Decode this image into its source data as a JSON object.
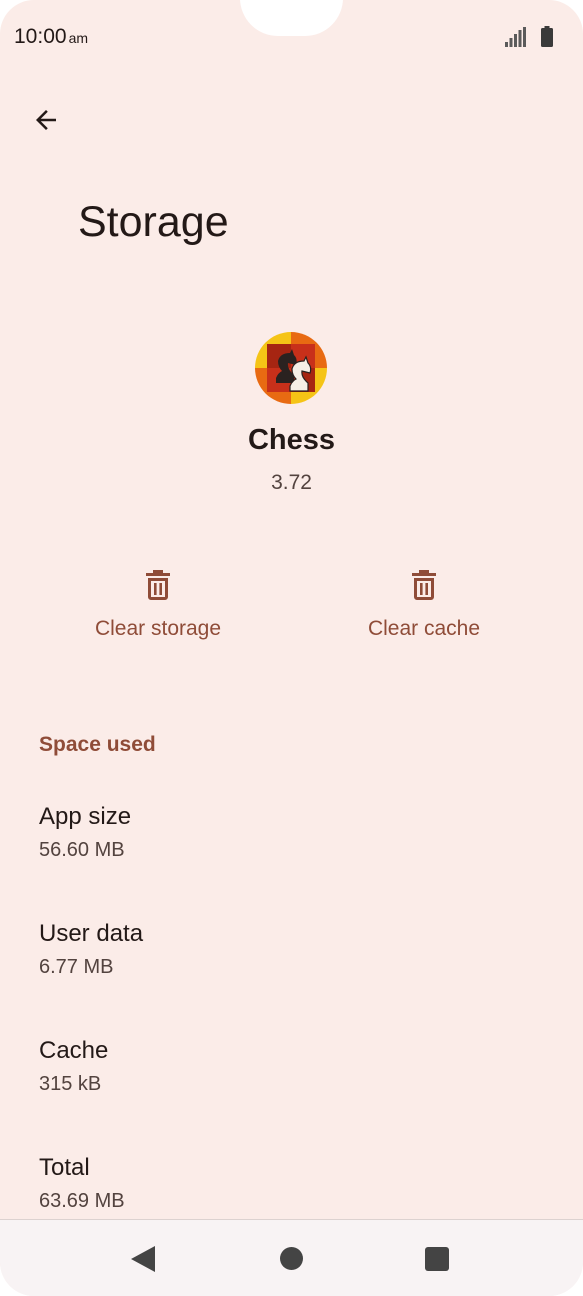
{
  "status_bar": {
    "time": "10:00",
    "ampm": "am"
  },
  "header": {
    "title": "Storage"
  },
  "app": {
    "name": "Chess",
    "version": "3.72",
    "icon": "chess-knight-icon"
  },
  "actions": [
    {
      "label": "Clear storage",
      "icon": "trash-icon"
    },
    {
      "label": "Clear cache",
      "icon": "trash-icon"
    }
  ],
  "space_used": {
    "header": "Space used",
    "rows": [
      {
        "title": "App size",
        "value": "56.60 MB"
      },
      {
        "title": "User data",
        "value": "6.77 MB"
      },
      {
        "title": "Cache",
        "value": "315 kB"
      },
      {
        "title": "Total",
        "value": "63.69 MB"
      }
    ]
  },
  "colors": {
    "background": "#fbece8",
    "accent": "#8f4c38",
    "text": "#231917"
  }
}
